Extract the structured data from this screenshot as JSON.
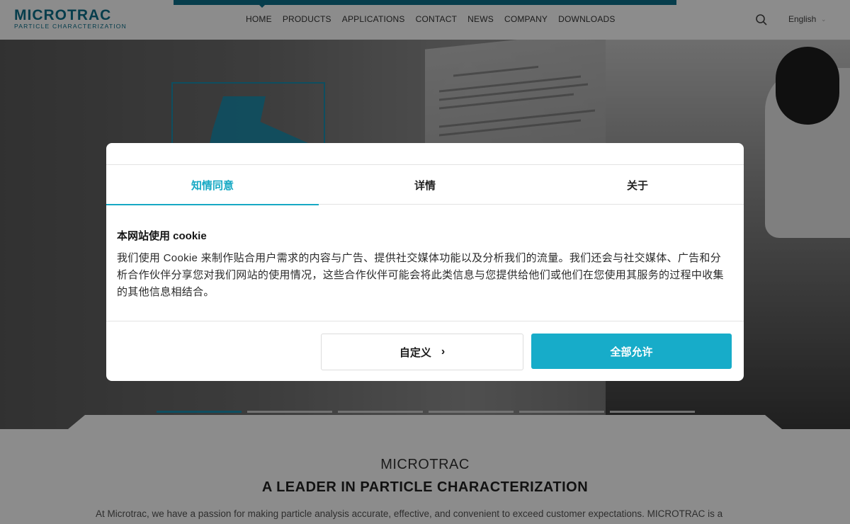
{
  "header": {
    "logo_main": "MICROTRAC",
    "logo_sub": "PARTICLE CHARACTERIZATION",
    "nav": [
      "HOME",
      "PRODUCTS",
      "APPLICATIONS",
      "CONTACT",
      "NEWS",
      "COMPANY",
      "DOWNLOADS"
    ],
    "language": "English",
    "search_icon": "search-icon",
    "accent_color": "#0b6f8a"
  },
  "hero": {
    "slides": 6,
    "active_slide": 1
  },
  "cookie_dialog": {
    "tabs": [
      "知情同意",
      "详情",
      "关于"
    ],
    "active_tab": "知情同意",
    "heading": "本网站使用 cookie",
    "body_lines": [
      "我们使用 Cookie 来制作贴合用户需求的内容与广告、提供社交媒体功能以及分析我们的流量。我们还会与社交媒体、广告和分",
      "析合作伙伴分享您对我们网站的使用情况，这些合作伙伴可能会将此类信息与您提供给他们或他们在您使用其服务的过程中收集",
      "的其他信息相结合。"
    ],
    "customize_label": "自定义",
    "customize_icon": "chevron-right-icon",
    "allow_all_label": "全部允许",
    "accent_color": "#17acc9"
  },
  "section": {
    "label": "MICROTRAC",
    "title": "A LEADER IN PARTICLE CHARACTERIZATION",
    "text": "At Microtrac, we have a passion for making particle analysis accurate, effective, and convenient to exceed customer expectations. MICROTRAC is a"
  }
}
